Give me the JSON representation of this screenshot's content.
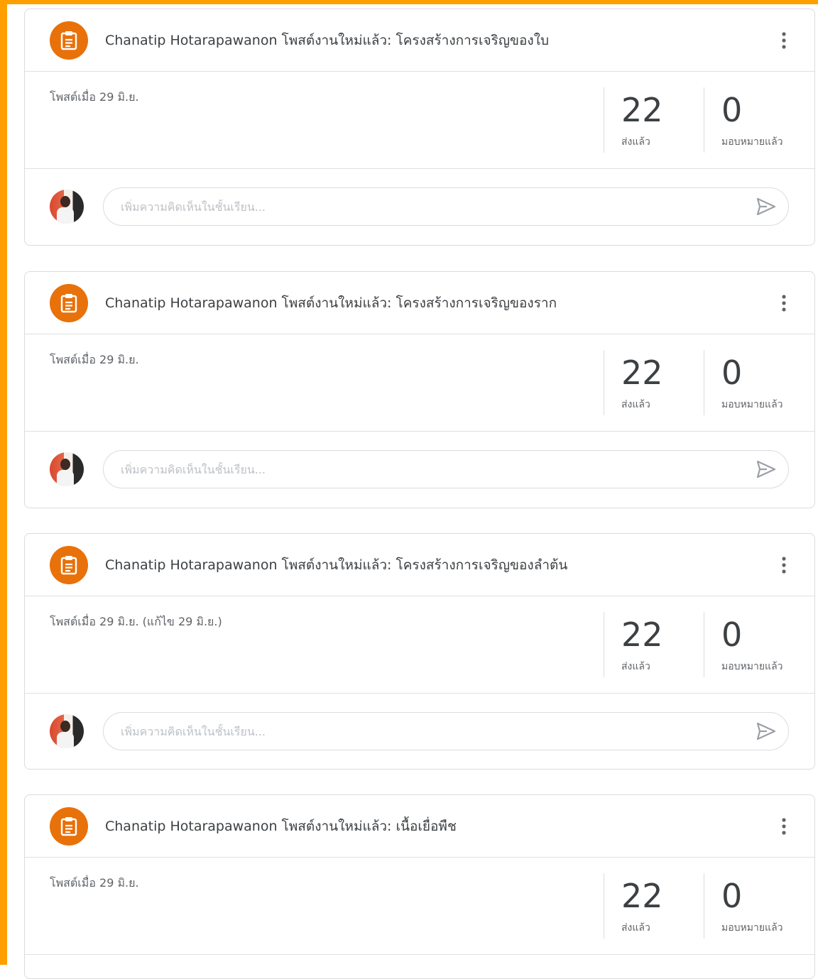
{
  "posts": [
    {
      "title": "Chanatip Hotarapawanon โพสต์งานใหม่แล้ว: โครงสร้างการเจริญของใบ",
      "posted": "โพสต์เมื่อ 29 มิ.ย.",
      "turned_in_count": "22",
      "turned_in_label": "ส่งแล้ว",
      "assigned_count": "0",
      "assigned_label": "มอบหมายแล้ว",
      "comment_placeholder": "เพิ่มความคิดเห็นในชั้นเรียน..."
    },
    {
      "title": "Chanatip Hotarapawanon โพสต์งานใหม่แล้ว: โครงสร้างการเจริญของราก",
      "posted": "โพสต์เมื่อ 29 มิ.ย.",
      "turned_in_count": "22",
      "turned_in_label": "ส่งแล้ว",
      "assigned_count": "0",
      "assigned_label": "มอบหมายแล้ว",
      "comment_placeholder": "เพิ่มความคิดเห็นในชั้นเรียน..."
    },
    {
      "title": "Chanatip Hotarapawanon โพสต์งานใหม่แล้ว: โครงสร้างการเจริญของลำต้น",
      "posted": "โพสต์เมื่อ 29 มิ.ย. (แก้ไข 29 มิ.ย.)",
      "turned_in_count": "22",
      "turned_in_label": "ส่งแล้ว",
      "assigned_count": "0",
      "assigned_label": "มอบหมายแล้ว",
      "comment_placeholder": "เพิ่มความคิดเห็นในชั้นเรียน..."
    },
    {
      "title": "Chanatip Hotarapawanon โพสต์งานใหม่แล้ว: เนื้อเยื่อพืช",
      "posted": "โพสต์เมื่อ 29 มิ.ย.",
      "turned_in_count": "22",
      "turned_in_label": "ส่งแล้ว",
      "assigned_count": "0",
      "assigned_label": "มอบหมายแล้ว"
    }
  ],
  "icons": {
    "assignment": "assignment-icon",
    "more": "more-vert-icon",
    "send": "send-icon",
    "avatar": "user-avatar"
  },
  "colors": {
    "frame": "#ff9f00",
    "assignment_icon_bg": "#e8710a"
  }
}
